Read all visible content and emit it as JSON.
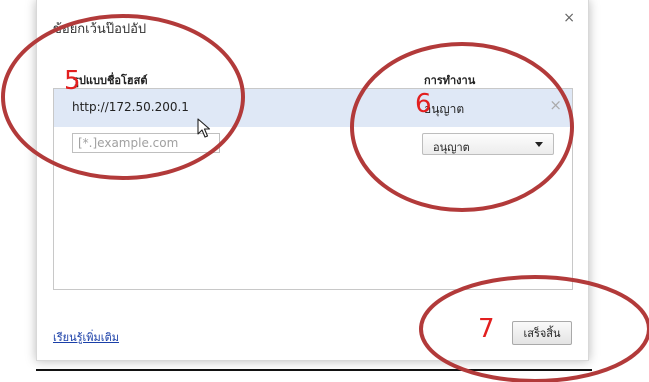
{
  "dialog": {
    "title": "ข้อยกเว้นป๊อปอัป",
    "close_glyph": "×"
  },
  "columns": {
    "pattern_header": "รูปแบบชื่อโฮสต์",
    "action_header": "การทำงาน"
  },
  "rows": [
    {
      "host": "http://172.50.200.1",
      "action": "อนุญาต",
      "remove_glyph": "×"
    }
  ],
  "new_entry": {
    "host_placeholder": "[*.]example.com",
    "action_selected": "อนุญาต"
  },
  "footer": {
    "learn_more": "เรียนรู้เพิ่มเติม",
    "done_label": "เสร็จสิ้น"
  },
  "callouts": {
    "a": "5",
    "b": "6",
    "c": "7"
  },
  "colors": {
    "callout_red": "#e21f1f",
    "ellipse_stroke": "#b23a3a",
    "selected_row": "#dfe8f6",
    "link_blue": "#1a3fa8"
  },
  "icons": {
    "cursor": "mouse-pointer-icon",
    "dropdown": "triangle-down-icon"
  }
}
